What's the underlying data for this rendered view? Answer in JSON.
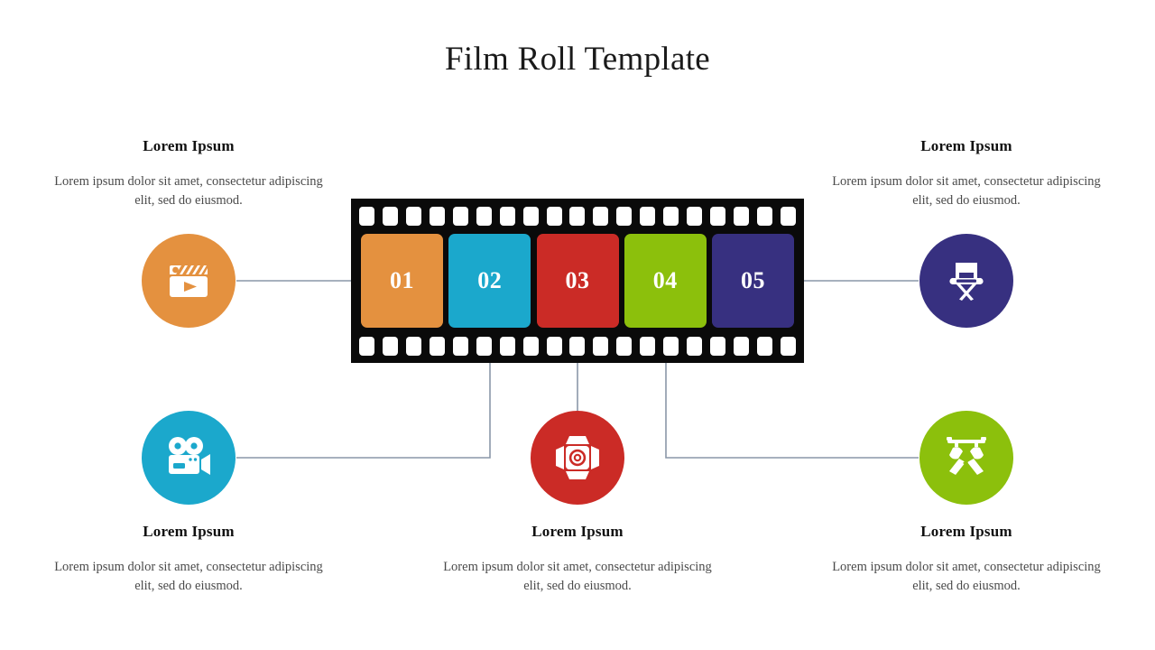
{
  "page": {
    "title": "Film Roll Template",
    "background": "#ffffff"
  },
  "colors": {
    "orange": "#E4913F",
    "cyan": "#1BA8CC",
    "red": "#CB2B26",
    "green": "#8CC00C",
    "purple": "#373080",
    "film_black": "#0a0a0a",
    "connector_line": "#8a97a8",
    "connector_dot": "#3E4D66",
    "heading_text": "#111111",
    "body_text": "#4a4a4a",
    "title_text": "#1a1a1a"
  },
  "film_strip": {
    "sprocket_count_per_row": 19,
    "frames": [
      {
        "number": "01",
        "color": "#E4913F"
      },
      {
        "number": "02",
        "color": "#1BA8CC"
      },
      {
        "number": "03",
        "color": "#CB2B26"
      },
      {
        "number": "04",
        "color": "#8CC00C"
      },
      {
        "number": "05",
        "color": "#373080"
      }
    ]
  },
  "items": [
    {
      "id": "item-01",
      "number": "01",
      "icon": "clapperboard-play-icon",
      "color": "#E4913F",
      "heading": "Lorem Ipsum",
      "body": "Lorem ipsum dolor sit amet, consectetur adipiscing elit, sed do eiusmod.",
      "position": "top-left"
    },
    {
      "id": "item-02",
      "number": "02",
      "icon": "movie-camera-icon",
      "color": "#1BA8CC",
      "heading": "Lorem Ipsum",
      "body": "Lorem ipsum dolor sit amet, consectetur adipiscing elit, sed do eiusmod.",
      "position": "bottom-left"
    },
    {
      "id": "item-03",
      "number": "03",
      "icon": "studio-spotlight-icon",
      "color": "#CB2B26",
      "heading": "Lorem Ipsum",
      "body": "Lorem ipsum dolor sit amet, consectetur adipiscing elit, sed do eiusmod.",
      "position": "bottom-center"
    },
    {
      "id": "item-04",
      "number": "04",
      "icon": "crossed-stage-lights-icon",
      "color": "#8CC00C",
      "heading": "Lorem Ipsum",
      "body": "Lorem ipsum dolor sit amet, consectetur adipiscing elit, sed do eiusmod.",
      "position": "bottom-right"
    },
    {
      "id": "item-05",
      "number": "05",
      "icon": "director-chair-icon",
      "color": "#373080",
      "heading": "Lorem Ipsum",
      "body": "Lorem ipsum dolor sit amet, consectetur adipiscing elit, sed do eiusmod.",
      "position": "top-right"
    }
  ]
}
